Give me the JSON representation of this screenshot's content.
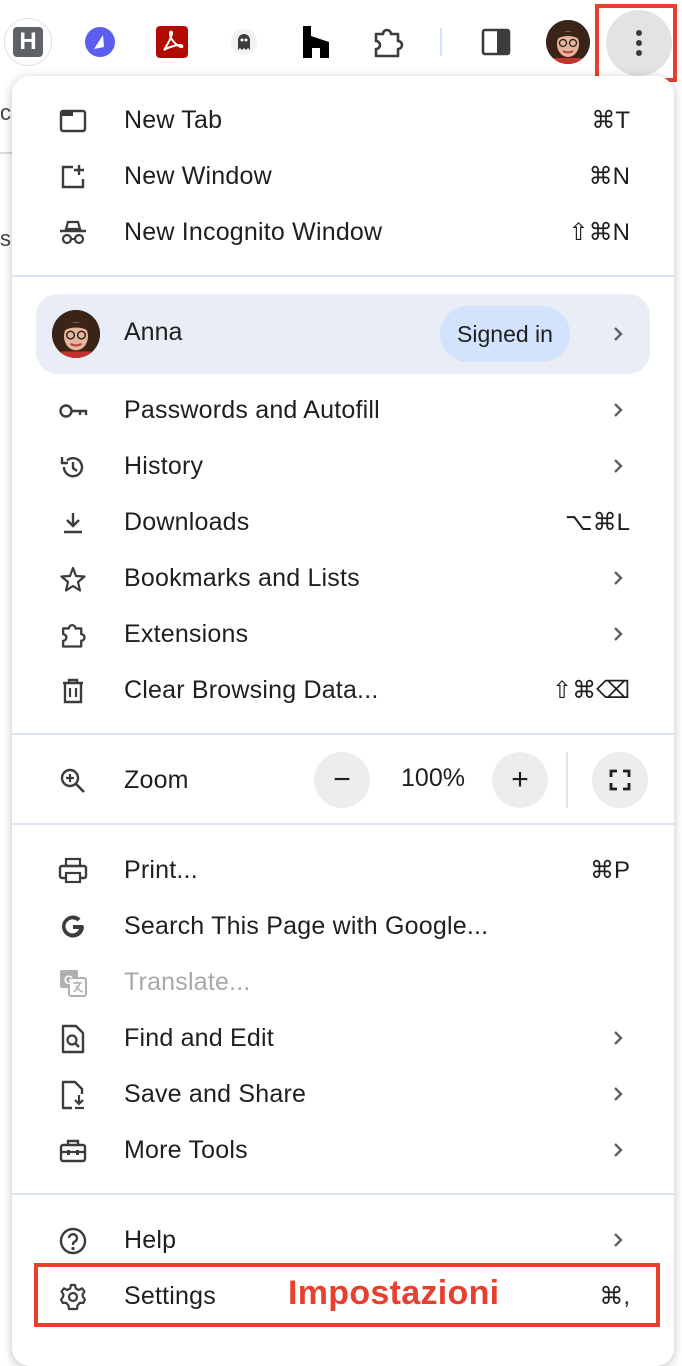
{
  "toolbar": {
    "extensions": [
      {
        "name": "h-extension-icon",
        "letter": "H"
      },
      {
        "name": "a-extension-icon"
      },
      {
        "name": "adobe-pdf-icon"
      },
      {
        "name": "ghostery-icon"
      },
      {
        "name": "houzz-icon"
      },
      {
        "name": "puzzle-icon"
      }
    ],
    "side_panel_icon": "side-panel-icon",
    "menu_icon": "kebab-icon"
  },
  "menu": {
    "group1": [
      {
        "label": "New Tab",
        "shortcut": "⌘T",
        "icon": "new-tab-icon"
      },
      {
        "label": "New Window",
        "shortcut": "⌘N",
        "icon": "new-window-icon"
      },
      {
        "label": "New Incognito Window",
        "shortcut": "⇧⌘N",
        "icon": "incognito-icon"
      }
    ],
    "profile": {
      "name": "Anna",
      "status": "Signed in"
    },
    "group2": [
      {
        "label": "Passwords and Autofill",
        "icon": "key-icon"
      },
      {
        "label": "History",
        "icon": "history-icon"
      },
      {
        "label": "Downloads",
        "shortcut": "⌥⌘L",
        "icon": "download-icon"
      },
      {
        "label": "Bookmarks and Lists",
        "icon": "star-icon"
      },
      {
        "label": "Extensions",
        "icon": "puzzle-icon"
      },
      {
        "label": "Clear Browsing Data...",
        "shortcut": "⇧⌘⌫",
        "icon": "trash-icon"
      }
    ],
    "zoom": {
      "label": "Zoom",
      "value": "100%",
      "minus": "−",
      "plus": "+"
    },
    "group3": [
      {
        "label": "Print...",
        "shortcut": "⌘P",
        "icon": "print-icon"
      },
      {
        "label": "Search This Page with Google...",
        "icon": "google-icon"
      },
      {
        "label": "Translate...",
        "icon": "translate-icon",
        "disabled": true
      },
      {
        "label": "Find and Edit",
        "icon": "find-icon"
      },
      {
        "label": "Save and Share",
        "icon": "save-share-icon"
      },
      {
        "label": "More Tools",
        "icon": "toolbox-icon"
      }
    ],
    "group4": [
      {
        "label": "Help",
        "icon": "help-icon"
      },
      {
        "label": "Settings",
        "shortcut": "⌘,",
        "icon": "gear-icon"
      }
    ]
  },
  "annotation": {
    "text": "Impostazioni",
    "color": "#e8402f"
  },
  "background_fragments": {
    "top": "c",
    "middle": "s"
  },
  "colors": {
    "accent": "#d3e3fd",
    "profile_bg": "#e8edf6",
    "highlight": "#e8402f"
  }
}
